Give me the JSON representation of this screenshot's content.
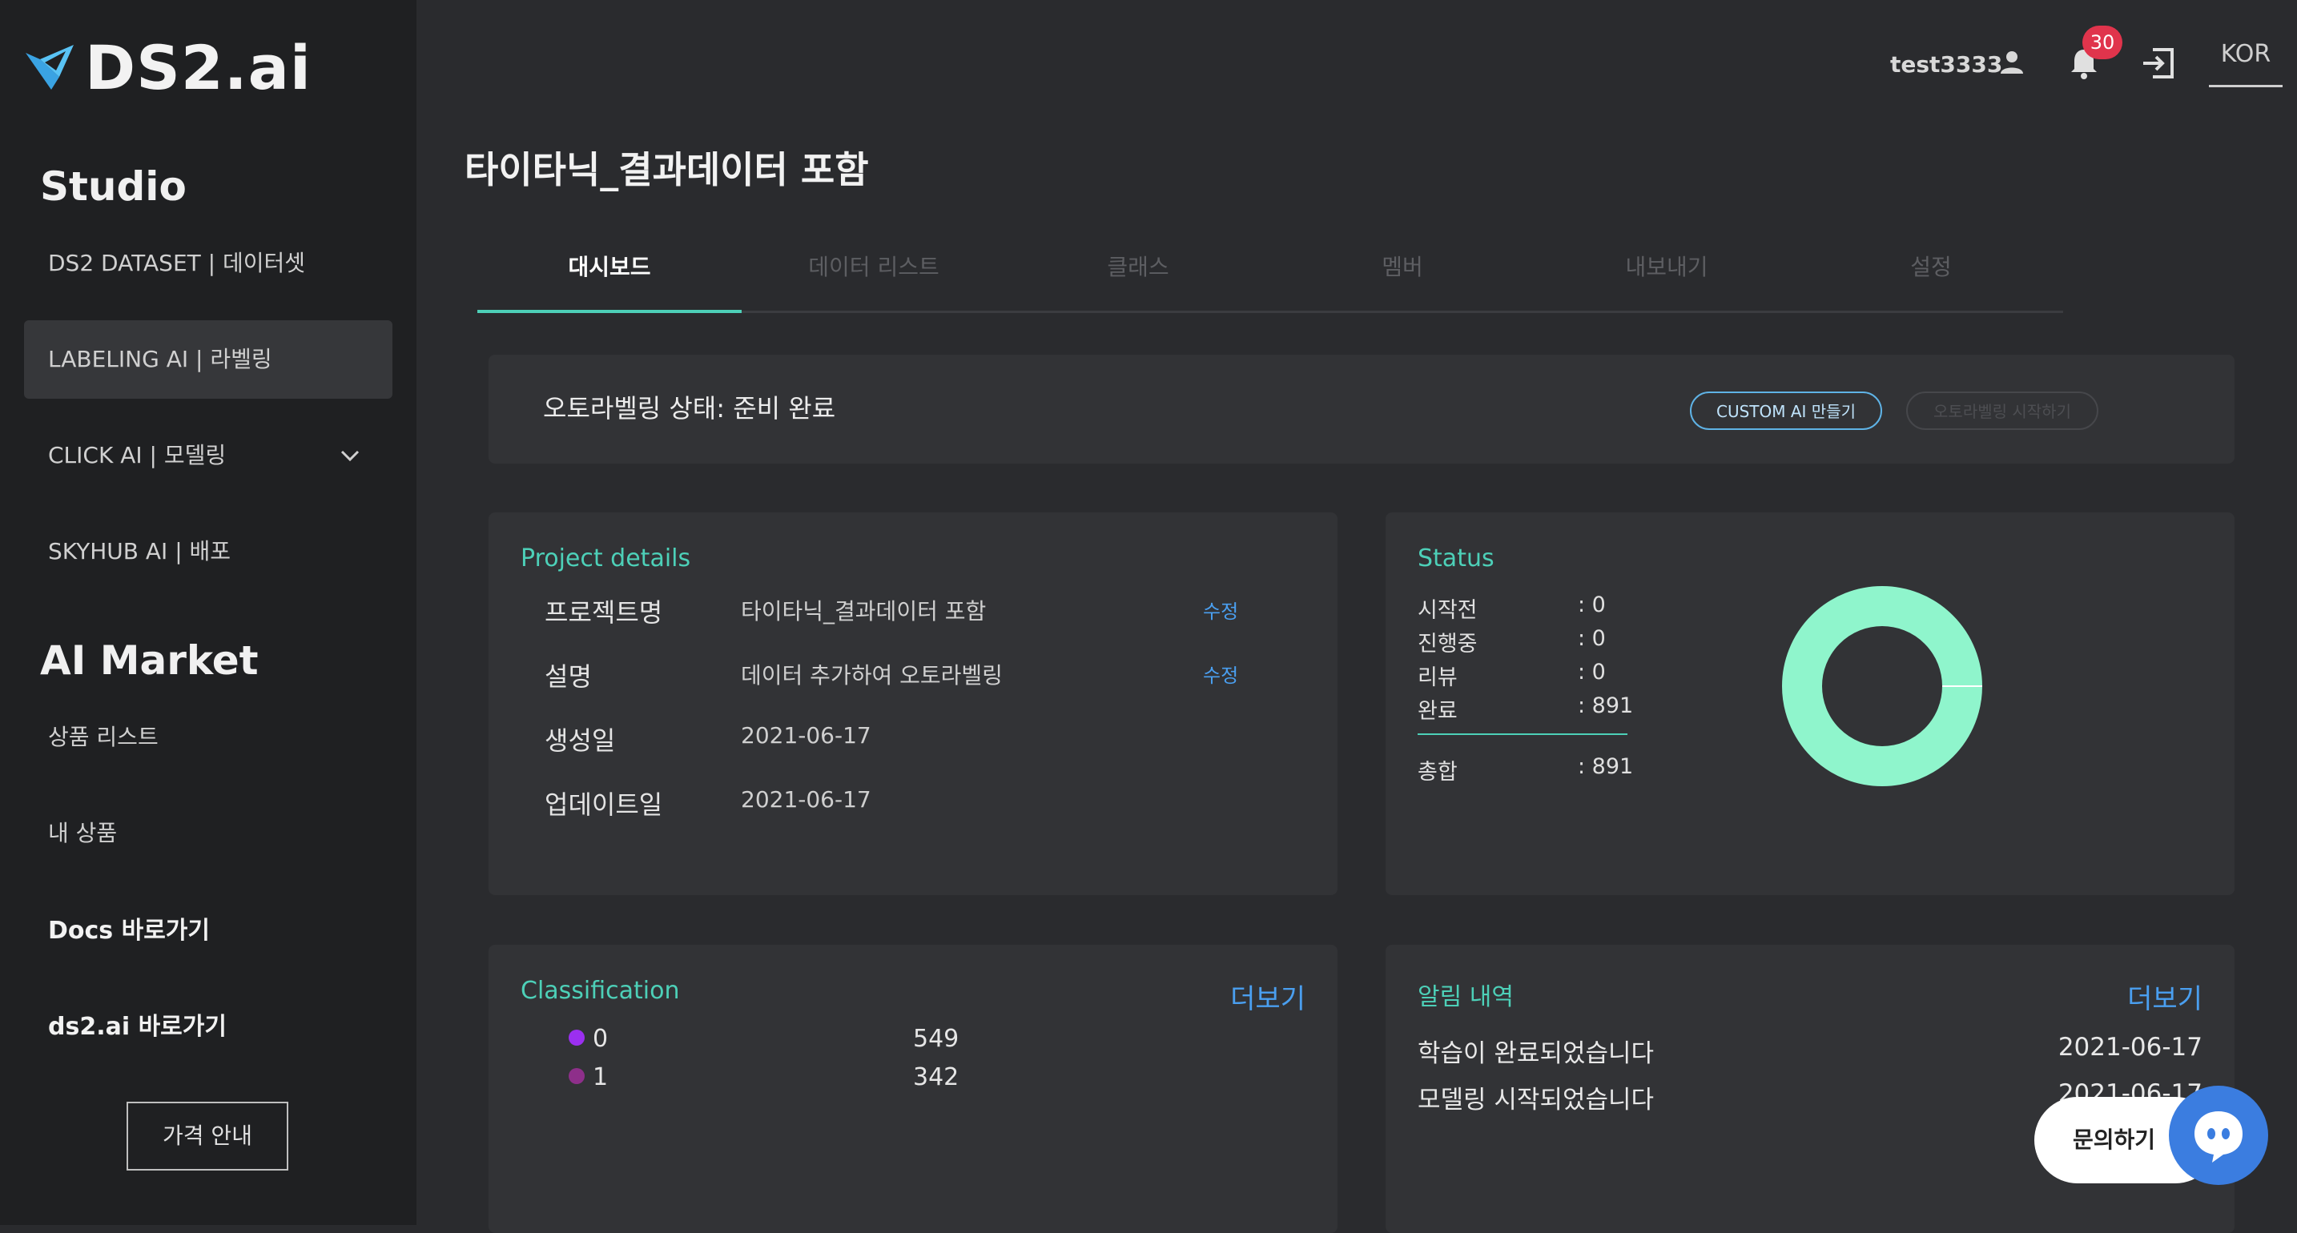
{
  "app": {
    "logo_text": "DS2.ai"
  },
  "sidebar": {
    "studio_title": "Studio",
    "studio_items": [
      {
        "label": "DS2 DATASET | 데이터셋"
      },
      {
        "label": "LABELING AI | 라벨링"
      },
      {
        "label": "CLICK AI | 모델링"
      },
      {
        "label": "SKYHUB AI | 배포"
      }
    ],
    "market_title": "AI Market",
    "market_items": [
      {
        "label": "상품 리스트"
      },
      {
        "label": "내 상품"
      }
    ],
    "links": [
      {
        "label": "Docs 바로가기"
      },
      {
        "label": "ds2.ai 바로가기"
      }
    ],
    "price_button": "가격 안내"
  },
  "header": {
    "username": "test3333",
    "notification_count": "30",
    "language": "KOR"
  },
  "page": {
    "title": "타이타닉_결과데이터 포함"
  },
  "tabs": [
    {
      "label": "대시보드"
    },
    {
      "label": "데이터 리스트"
    },
    {
      "label": "클래스"
    },
    {
      "label": "멤버"
    },
    {
      "label": "내보내기"
    },
    {
      "label": "설정"
    }
  ],
  "autolabel": {
    "status_text": "오토라벨링 상태: 준비 완료",
    "custom_ai_button": "CUSTOM AI 만들기",
    "start_button": "오토라벨링 시작하기"
  },
  "project_details": {
    "title": "Project details",
    "rows": [
      {
        "label": "프로젝트명",
        "value": "타이타닉_결과데이터 포함",
        "edit": "수정"
      },
      {
        "label": "설명",
        "value": "데이터 추가하여 오토라벨링",
        "edit": "수정"
      },
      {
        "label": "생성일",
        "value": "2021-06-17"
      },
      {
        "label": "업데이트일",
        "value": "2021-06-17"
      }
    ]
  },
  "status": {
    "title": "Status",
    "rows": [
      {
        "label": "시작전",
        "value": ": 0"
      },
      {
        "label": "진행중",
        "value": ": 0"
      },
      {
        "label": "리뷰",
        "value": ": 0"
      },
      {
        "label": "완료",
        "value": ": 891"
      }
    ],
    "total": {
      "label": "총합",
      "value": ": 891"
    },
    "donut_completed_fraction": 1.0,
    "donut_color": "#8ff5cc"
  },
  "classification": {
    "title": "Classification",
    "more": "더보기",
    "rows": [
      {
        "label": "0",
        "count": "549",
        "color": "#9b2ff0"
      },
      {
        "label": "1",
        "count": "342",
        "color": "#8e2f8a"
      }
    ]
  },
  "notifications": {
    "title": "알림 내역",
    "more": "더보기",
    "rows": [
      {
        "text": "학습이 완료되었습니다",
        "date": "2021-06-17"
      },
      {
        "text": "모델링 시작되었습니다",
        "date": "2021-06-17"
      }
    ]
  },
  "chat": {
    "label": "문의하기"
  },
  "colors": {
    "accent": "#4dd0b8",
    "link": "#4a9ff0",
    "badge": "#e0344c"
  }
}
